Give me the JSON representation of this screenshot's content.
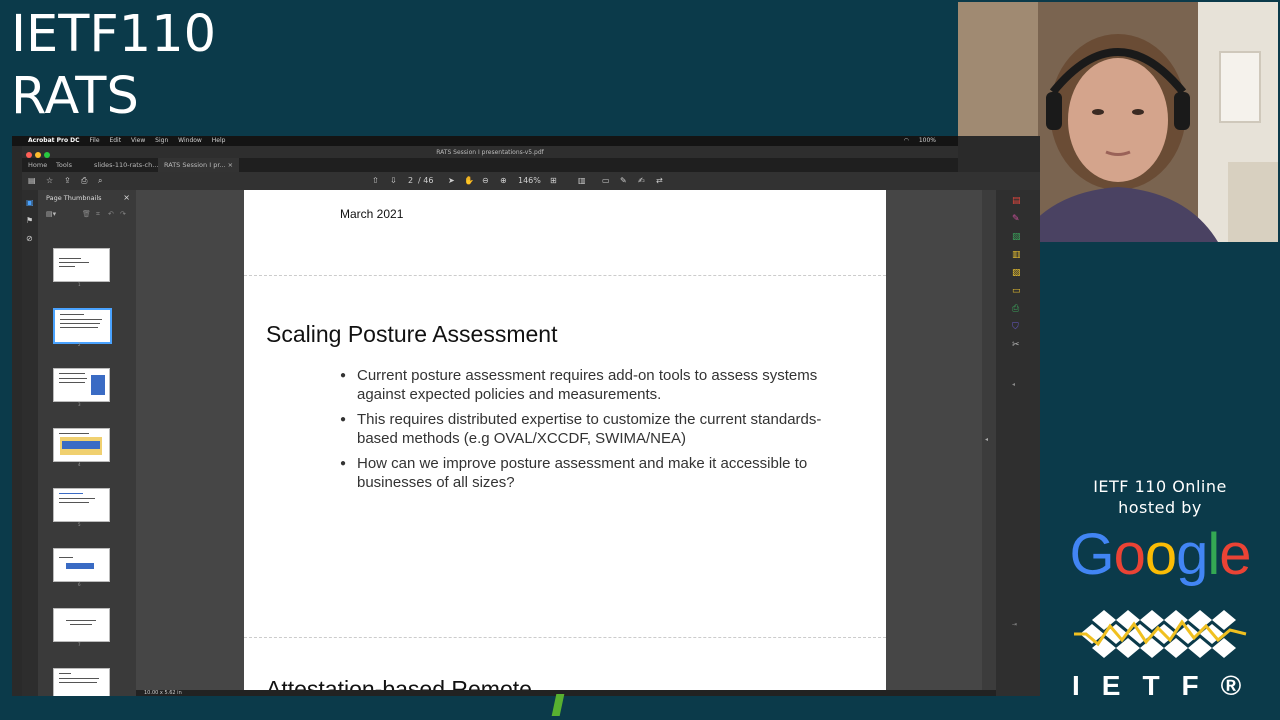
{
  "conference": {
    "line1": "IETF110",
    "line2": "RATS"
  },
  "branding": {
    "online_line1": "IETF 110 Online",
    "online_line2": "hosted by",
    "google_letters": [
      {
        "ch": "G",
        "color": "#4285F4"
      },
      {
        "ch": "o",
        "color": "#EA4335"
      },
      {
        "ch": "o",
        "color": "#FBBC05"
      },
      {
        "ch": "g",
        "color": "#4285F4"
      },
      {
        "ch": "l",
        "color": "#34A853"
      },
      {
        "ch": "e",
        "color": "#EA4335"
      }
    ],
    "ietf_text": "IETF®"
  },
  "mac_menubar": {
    "app": "Acrobat Pro DC",
    "items": [
      "File",
      "Edit",
      "View",
      "Sign",
      "Window",
      "Help"
    ],
    "battery": "100%"
  },
  "window": {
    "title": "RATS Session I presentations-v5.pdf"
  },
  "tabs": {
    "home": "Home",
    "tools": "Tools",
    "tab1": "slides-110-rats-ch...",
    "tab2": "RATS Session I pr..."
  },
  "toolbar": {
    "page_current": "2",
    "page_total": "/ 46",
    "zoom": "146%"
  },
  "thumbnails": {
    "header": "Page Thumbnails",
    "pages": [
      "1",
      "2",
      "3",
      "4",
      "5",
      "6",
      "7",
      "8"
    ]
  },
  "document": {
    "date": "March 2021",
    "slide_title": "Scaling Posture Assessment",
    "bullets": [
      "Current posture assessment requires add-on tools to assess systems against expected policies and measurements.",
      "This requires distributed expertise to customize the current standards-based methods (e.g OVAL/XCCDF, SWIMA/NEA)",
      "How can we improve posture assessment and make it accessible to businesses of all sizes?"
    ],
    "next_slide_title": "Attestation-based Remote"
  },
  "statusbar": {
    "size": "10.00 x 5.62 in"
  },
  "colors": {
    "background": "#0b3a4a",
    "ietf_yellow": "#f0c020"
  }
}
